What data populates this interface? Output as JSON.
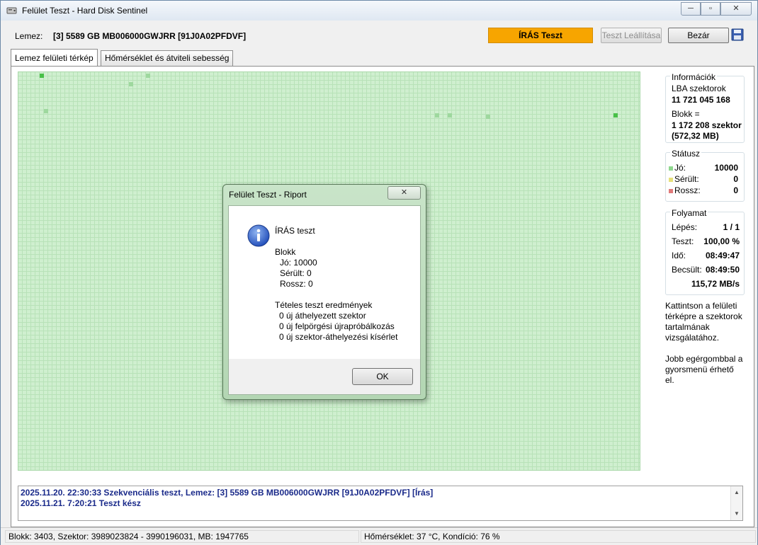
{
  "window": {
    "title": "Felület Teszt - Hard Disk Sentinel",
    "buttons": {
      "min": "─",
      "max": "▫",
      "close": "✕"
    }
  },
  "header": {
    "disk_label": "Lemez:",
    "disk_value": "[3] 5589 GB  MB006000GWJRR [91J0A02PFDVF]",
    "status": "ÍRÁS Teszt",
    "stop_button": "Teszt Leállítása",
    "close_button": "Bezár",
    "save_icon": "floppy-disk-icon"
  },
  "tabs": [
    {
      "label": "Lemez felületi térkép",
      "active": true
    },
    {
      "label": "Hőmérséklet és átviteli sebesség",
      "active": false
    }
  ],
  "info": {
    "title": "Információk",
    "lba_label": "LBA szektorok",
    "lba_value": "11 721 045 168",
    "block_label": "Blokk =",
    "block_value": "1 172 208 szektor",
    "block_size": "(572,32 MB)"
  },
  "status": {
    "title": "Státusz",
    "rows": [
      {
        "label": "Jó:",
        "value": "10000",
        "color": "#8fd88f"
      },
      {
        "label": "Sérült:",
        "value": "0",
        "color": "#e6e07a"
      },
      {
        "label": "Rossz:",
        "value": "0",
        "color": "#e07a7a"
      }
    ]
  },
  "progress": {
    "title": "Folyamat",
    "rows": [
      {
        "label": "Lépés:",
        "value": "1 / 1"
      },
      {
        "label": "Teszt:",
        "value": "100,00 %"
      },
      {
        "label": "Idő:",
        "value": "08:49:47"
      },
      {
        "label": "Becsült:",
        "value": "08:49:50"
      }
    ],
    "speed": "115,72 MB/s"
  },
  "hints": {
    "line1": "Kattintson a felületi térképre a szektorok tartalmának vizsgálatához.",
    "line2": "Jobb egérgombbal a gyorsmenü érhető el."
  },
  "log": [
    "2025.11.20.  22:30:33   Szekvenciális teszt, Lemez: [3] 5589 GB  MB006000GWJRR [91J0A02PFDVF] [Írás]",
    "2025.11.21.  7:20:21   Teszt kész"
  ],
  "statusbar": {
    "left": "Blokk: 3403, Szektor: 3989023824 - 3990196031, MB: 1947765",
    "right": "Hőmérséklet: 37  °C,  Kondíció: 76 %"
  },
  "dialog": {
    "title": "Felület Teszt - Riport",
    "close": "✕",
    "heading": "ÍRÁS teszt",
    "block_label": "Blokk",
    "good": "Jó: 10000",
    "damaged": "Sérült: 0",
    "bad": "Rossz: 0",
    "results_label": "Tételes teszt eredmények",
    "r1": "0 új áthelyezett szektor",
    "r2": "0 új felpörgési újrapróbálkozás",
    "r3": "0 új szektor-áthelyezési kísérlet",
    "ok": "OK"
  }
}
